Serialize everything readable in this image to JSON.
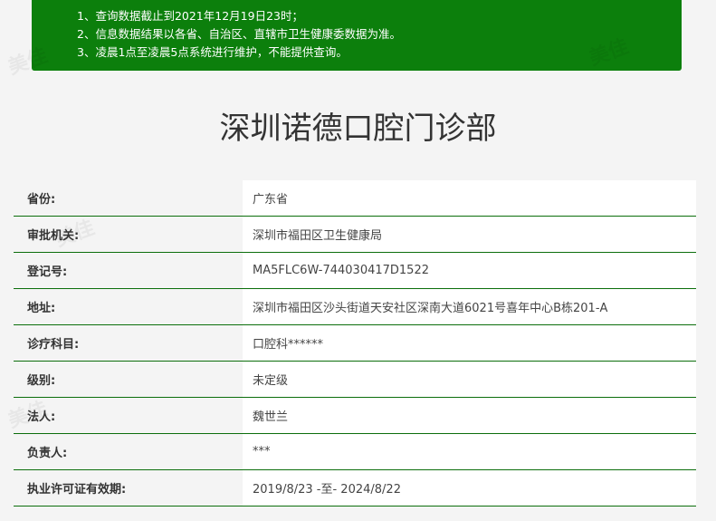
{
  "notice": {
    "lines": [
      "1、查询数据截止到2021年12月19日23时；",
      "2、信息数据结果以各省、自治区、直辖市卫生健康委数据为准。",
      "3、凌晨1点至凌晨5点系统进行维护，不能提供查询。"
    ]
  },
  "page_title": "深圳诺德口腔门诊部",
  "rows": [
    {
      "label": "省份:",
      "value": "广东省"
    },
    {
      "label": "审批机关:",
      "value": "深圳市福田区卫生健康局"
    },
    {
      "label": "登记号:",
      "value": "MA5FLC6W-744030417D1522"
    },
    {
      "label": "地址:",
      "value": "深圳市福田区沙头街道天安社区深南大道6021号喜年中心B栋201-A"
    },
    {
      "label": "诊疗科目:",
      "value": "口腔科******"
    },
    {
      "label": "级别:",
      "value": "未定级"
    },
    {
      "label": "法人:",
      "value": "魏世兰"
    },
    {
      "label": "负责人:",
      "value": "***"
    },
    {
      "label": "执业许可证有效期:",
      "value": "2019/8/23 -至- 2024/8/22"
    }
  ],
  "watermark": "美佳"
}
